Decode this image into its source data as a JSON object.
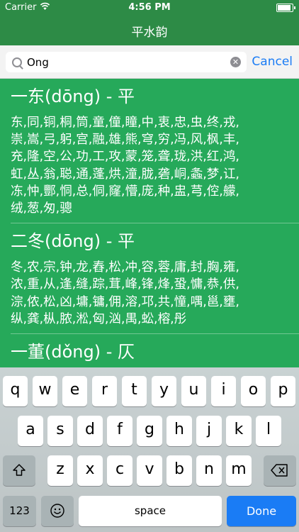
{
  "status": {
    "carrier": "Carrier",
    "time": "4:56 PM"
  },
  "nav": {
    "title": "平水韵"
  },
  "search": {
    "value": "Ong",
    "cancel": "Cancel"
  },
  "sections": [
    {
      "heading": "一东(dōng) - 平",
      "lines": [
        "东,同,铜,桐,筒,童,僮,瞳,中,衷,忠,虫,终,戎,",
        "崇,嵩,弓,躬,宫,融,雄,熊,穹,穷,冯,风,枫,丰,",
        "充,隆,空,公,功,工,攻,蒙,笼,聋,珑,洪,红,鸿,",
        "虹,丛,翁,聪,通,蓬,烘,潼,胧,砻,峒,螽,梦,讧,",
        "冻,忡,酆,恫,总,侗,窿,懵,庞,种,盅,芎,倥,艨,",
        "绒,葱,匆,骢"
      ]
    },
    {
      "heading": "二冬(dōng) - 平",
      "lines": [
        "冬,农,宗,钟,龙,舂,松,冲,容,蓉,庸,封,胸,雍,",
        "浓,重,从,逢,缝,踪,茸,峰,锋,烽,蛩,慵,恭,供,",
        "淙,侬,松,凶,墉,镛,佣,溶,邛,共,憧,喁,邕,壅,",
        "纵,龚,枞,脓,淞,匈,汹,禺,蚣,榕,彤"
      ]
    },
    {
      "heading": "一董(dǒng) - 仄",
      "lines": []
    }
  ],
  "keyboard": {
    "row1": [
      "q",
      "w",
      "e",
      "r",
      "t",
      "y",
      "u",
      "i",
      "o",
      "p"
    ],
    "row2": [
      "a",
      "s",
      "d",
      "f",
      "g",
      "h",
      "j",
      "k",
      "l"
    ],
    "row3": [
      "z",
      "x",
      "c",
      "v",
      "b",
      "n",
      "m"
    ],
    "numbers": "123",
    "space": "space",
    "done": "Done",
    "shift_icon": "shift-icon",
    "delete_icon": "delete-icon",
    "emoji_icon": "emoji-icon"
  }
}
